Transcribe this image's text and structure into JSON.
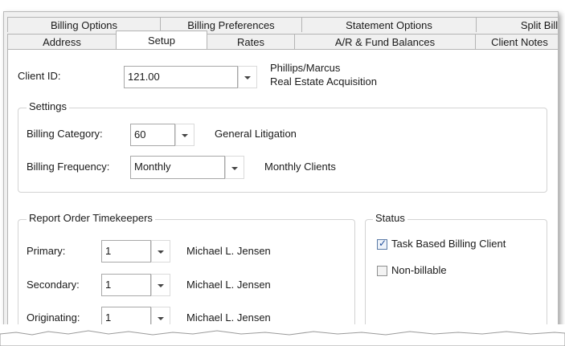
{
  "tabs_row1": [
    "Billing Options",
    "Billing Preferences",
    "Statement Options",
    "Split Billi"
  ],
  "tabs_row2": [
    "Address",
    "Setup",
    "Rates",
    "A/R & Fund Balances",
    "Client Notes"
  ],
  "active_tab": "Setup",
  "client": {
    "label": "Client ID:",
    "value": "121.00",
    "name": "Phillips/Marcus",
    "matter": "Real Estate Acquisition"
  },
  "settings": {
    "title": "Settings",
    "billing_category_label": "Billing Category:",
    "billing_category_value": "60",
    "billing_category_desc": "General Litigation",
    "billing_frequency_label": "Billing Frequency:",
    "billing_frequency_value": "Monthly",
    "billing_frequency_desc": "Monthly Clients"
  },
  "timekeepers": {
    "title": "Report Order Timekeepers",
    "rows": [
      {
        "label": "Primary:",
        "value": "1",
        "name": "Michael L. Jensen"
      },
      {
        "label": "Secondary:",
        "value": "1",
        "name": "Michael L. Jensen"
      },
      {
        "label": "Originating:",
        "value": "1",
        "name": "Michael L. Jensen"
      }
    ]
  },
  "status": {
    "title": "Status",
    "task_based_label": "Task Based Billing Client",
    "task_based_checked": true,
    "non_billable_label": "Non-billable",
    "non_billable_checked": false
  }
}
